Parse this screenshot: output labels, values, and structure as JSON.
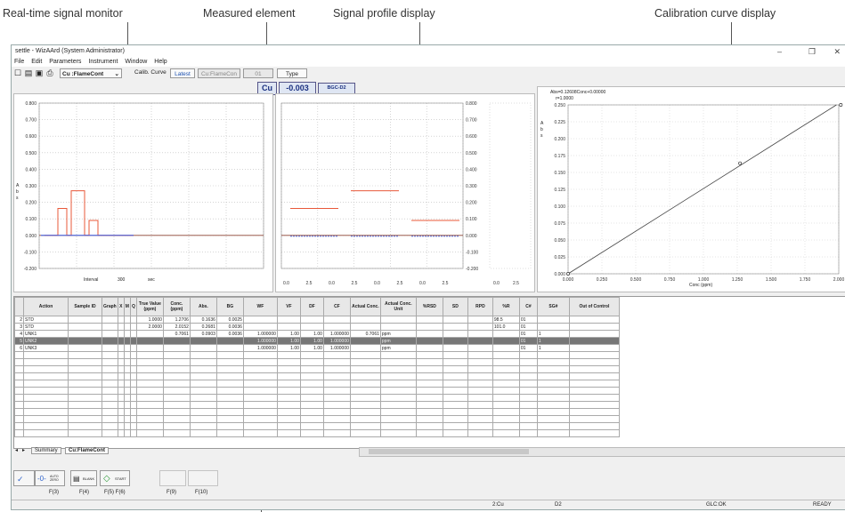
{
  "annotations": {
    "realtime": "Real-time signal monitor",
    "element": "Measured element",
    "profile": "Signal profile display",
    "calibration": "Calibration curve display"
  },
  "window": {
    "title": "settle - WizAArd (System Administrator)",
    "minimize": "–",
    "restore": "❐",
    "close": "✕"
  },
  "menu": [
    "File",
    "Edit",
    "Parameters",
    "Instrument",
    "Window",
    "Help"
  ],
  "toolbar": {
    "method": "Cu :FlameCont",
    "calib_label": "Calib. Curve",
    "latest": "Latest",
    "calib_name": "Cu:FlameCon",
    "calib_no": "01",
    "type": "Type"
  },
  "element_display": {
    "symbol": "Cu",
    "value": "-0.003",
    "mode": "BGC-D2"
  },
  "monitor": {
    "yticks": [
      "0.800",
      "0.700",
      "0.600",
      "0.500",
      "0.400",
      "0.300",
      "0.200",
      "0.100",
      "0.000",
      "-0.100",
      "-0.200"
    ],
    "ylabel": "A b s",
    "interval_label": "Interval",
    "interval_value": "300",
    "interval_unit": "sec"
  },
  "profile": {
    "yticks": [
      "0.800",
      "0.700",
      "0.600",
      "0.500",
      "0.400",
      "0.300",
      "0.200",
      "0.100",
      "0.000",
      "-0.100",
      "-0.200"
    ],
    "xticks": [
      "0.0",
      "2.5",
      "0.0",
      "2.5",
      "0.0",
      "2.5",
      "0.0",
      "2.5",
      "0.0",
      "2.5"
    ]
  },
  "calibration": {
    "equation": "Abs=0.12608Conc+0.00000",
    "r_value": "r=1.0000",
    "ylabel": "A b s",
    "yticks": [
      "0.250",
      "0.225",
      "0.200",
      "0.175",
      "0.150",
      "0.125",
      "0.100",
      "0.075",
      "0.050",
      "0.025",
      "0.000"
    ],
    "xticks": [
      "0.000",
      "0.250",
      "0.500",
      "0.750",
      "1.000",
      "1.250",
      "1.500",
      "1.750",
      "2.000"
    ],
    "xlabel": "Conc (ppm)"
  },
  "table": {
    "headers": [
      "",
      "Action",
      "Sample ID",
      "Graph",
      "X",
      "M",
      "Q",
      "True Value (ppm)",
      "Conc. (ppm)",
      "Abs.",
      "BG",
      "WF",
      "VF",
      "DF",
      "CF",
      "Actual Conc.",
      "Actual Conc. Unit",
      "%RSD",
      "SD",
      "RPD",
      "%R",
      "C#",
      "SG#",
      "Out of Control"
    ],
    "rows": [
      [
        "2",
        "STD",
        "",
        "",
        "",
        "",
        "",
        "1.0000",
        "1.2706",
        "0.1636",
        "0.0025",
        "",
        "",
        "",
        "",
        "",
        "",
        "",
        "",
        "",
        "98.5",
        "01",
        "",
        ""
      ],
      [
        "3",
        "STD",
        "",
        "",
        "",
        "",
        "",
        "2.0000",
        "2.0152",
        "0.2681",
        "0.0036",
        "",
        "",
        "",
        "",
        "",
        "",
        "",
        "",
        "",
        "101.0",
        "01",
        "",
        ""
      ],
      [
        "4",
        "UNK1",
        "",
        "",
        "",
        "",
        "",
        "",
        "0.7061",
        "0.0903",
        "0.0036",
        "1.000000",
        "1.00",
        "1.00",
        "1.000000",
        "0.7061",
        "ppm",
        "",
        "",
        "",
        "",
        "01",
        "1",
        ""
      ],
      [
        "5",
        "UNK2",
        "",
        "",
        "",
        "",
        "",
        "",
        "",
        "",
        "",
        "1.000000",
        "1.00",
        "1.00",
        "1.000000",
        "",
        "ppm",
        "",
        "",
        "",
        "",
        "01",
        "1",
        ""
      ],
      [
        "6",
        "UNK3",
        "",
        "",
        "",
        "",
        "",
        "",
        "",
        "",
        "",
        "1.000000",
        "1.00",
        "1.00",
        "1.000000",
        "",
        "ppm",
        "",
        "",
        "",
        "",
        "01",
        "1",
        ""
      ]
    ],
    "empty_rows": 12
  },
  "sheet_tabs": [
    "Summary",
    "Cu:FlameCont"
  ],
  "function_buttons": {
    "auto_zero": "AUTO ZERO",
    "blank": "BLANK",
    "start": "START"
  },
  "fkeys": [
    "F(3)",
    "F(4)",
    "F(5) F(6)",
    "F(9)",
    "F(10)"
  ],
  "status": {
    "element": "2:Cu",
    "mode": "D2",
    "lock": "GLC:OK",
    "state": "READY"
  },
  "colors": {
    "trace_red": "#e8583a",
    "trace_blue": "#3a5ee8",
    "selected_row": "#777777",
    "accent": "#3366cc"
  },
  "chart_data": [
    {
      "type": "line",
      "title": "",
      "xlabel": "",
      "ylabel": "Abs",
      "ylim": [
        -0.2,
        0.8
      ],
      "series": [
        {
          "values_x": [
            0,
            1,
            2,
            3,
            4,
            5,
            6,
            7,
            8,
            9,
            10,
            11,
            12,
            13,
            14,
            15,
            16,
            17,
            18,
            19,
            20
          ],
          "values_y": [
            0,
            0,
            0,
            0.163,
            0.163,
            0,
            0.27,
            0.27,
            0.27,
            0,
            0.09,
            0.09,
            0,
            0,
            0,
            0,
            0,
            0,
            0,
            0,
            0
          ]
        }
      ]
    },
    {
      "type": "line",
      "title": "",
      "ylim": [
        -0.2,
        0.8
      ],
      "series": [
        {
          "values_x": [
            0,
            1,
            2,
            3,
            4,
            5
          ],
          "values_y": [
            0.163,
            0.163,
            0.27,
            0.27,
            0.09,
            0.09
          ]
        }
      ]
    },
    {
      "type": "scatter",
      "title": "Abs=0.12608Conc+0.00000",
      "xlabel": "Conc (ppm)",
      "ylabel": "Abs",
      "xlim": [
        0,
        2.0
      ],
      "ylim": [
        0,
        0.25
      ],
      "points": [
        {
          "x": 0,
          "y": 0
        },
        {
          "x": 1.2706,
          "y": 0.1636
        },
        {
          "x": 2.0152,
          "y": 0.2681
        }
      ],
      "fit": {
        "slope": 0.12608,
        "intercept": 0
      }
    }
  ]
}
